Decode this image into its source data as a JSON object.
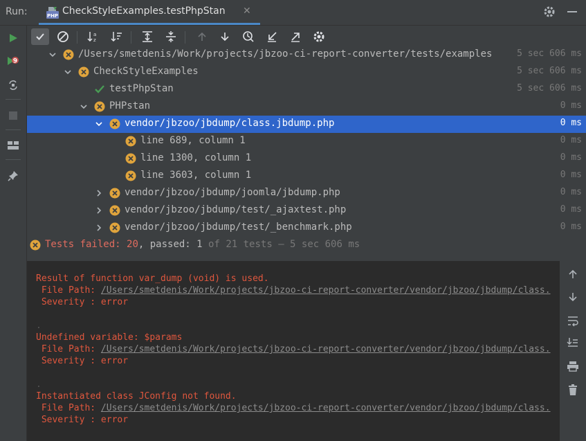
{
  "top": {
    "run_label": "Run:",
    "tab_title": "CheckStyleExamples.testPhpStan",
    "tab_icon": "php-icon",
    "tab_close": "✕"
  },
  "tree": {
    "rows": [
      {
        "label": "/Users/smetdenis/Work/projects/jbzoo-ci-report-converter/tests/examples",
        "time": "5 sec 606 ms",
        "status": "failed",
        "expanded": true
      },
      {
        "label": "CheckStyleExamples",
        "time": "5 sec 606 ms",
        "status": "failed",
        "expanded": true
      },
      {
        "label": "testPhpStan",
        "time": "5 sec 606 ms",
        "status": "passed"
      },
      {
        "label": "PHPstan",
        "time": "0 ms",
        "status": "failed",
        "expanded": true
      },
      {
        "label": "vendor/jbzoo/jbdump/class.jbdump.php",
        "time": "0 ms",
        "status": "failed",
        "expanded": true,
        "selected": true
      },
      {
        "label": "line 689, column 1",
        "time": "0 ms",
        "status": "failed"
      },
      {
        "label": "line 1300, column 1",
        "time": "0 ms",
        "status": "failed"
      },
      {
        "label": "line 3603, column 1",
        "time": "0 ms",
        "status": "failed"
      },
      {
        "label": "vendor/jbzoo/jbdump/joomla/jbdump.php",
        "time": "0 ms",
        "status": "failed",
        "expanded": false
      },
      {
        "label": "vendor/jbzoo/jbdump/test/_ajaxtest.php",
        "time": "0 ms",
        "status": "failed",
        "expanded": false
      },
      {
        "label": "vendor/jbzoo/jbdump/test/_benchmark.php",
        "time": "0 ms",
        "status": "failed",
        "expanded": false
      }
    ]
  },
  "status_line": {
    "failed_label": "Tests failed:",
    "failed_count": "20",
    "passed_label": ", passed:",
    "passed_count": "1",
    "rest": "of 21 tests – 5 sec 606 ms"
  },
  "console": {
    "messages": [
      {
        "title": "Result of function var_dump (void) is used.",
        "path_label": " File Path: ",
        "path": "/Users/smetdenis/Work/projects/jbzoo-ci-report-converter/vendor/jbzoo/jbdump/class.",
        "severity": " Severity : error",
        "trail": "."
      },
      {
        "title": "Undefined variable: $params",
        "path_label": " File Path: ",
        "path": "/Users/smetdenis/Work/projects/jbzoo-ci-report-converter/vendor/jbzoo/jbdump/class.",
        "severity": " Severity : error",
        "trail": "."
      },
      {
        "title": "Instantiated class JConfig not found.",
        "path_label": " File Path: ",
        "path": "/Users/smetdenis/Work/projects/jbzoo-ci-report-converter/vendor/jbzoo/jbdump/class.",
        "severity": " Severity : error",
        "trail": "."
      }
    ]
  },
  "colors": {
    "fail": "#e0a43c",
    "pass": "#499c54",
    "selected": "#2f65ca",
    "error_text": "#e0573e"
  }
}
